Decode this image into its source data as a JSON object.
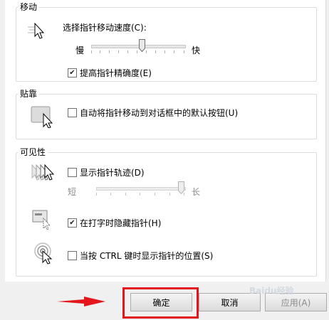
{
  "groups": {
    "motion": {
      "label": "移动",
      "speed_label": "选择指针移动速度(C):",
      "slow": "慢",
      "fast": "快",
      "speed_level": 0.55,
      "precision_label": "提高指针精确度(E)",
      "precision_checked": true
    },
    "snap": {
      "label": "贴靠",
      "snap_label": "自动将指针移动到对话框中的默认按钮(U)",
      "snap_checked": false
    },
    "visibility": {
      "label": "可见性",
      "trails_label": "显示指针轨迹(D)",
      "trails_checked": false,
      "short": "短",
      "long": "长",
      "trail_level": 1.0,
      "hide_label": "在打字时隐藏指针(H)",
      "hide_checked": true,
      "ctrl_label": "当按 CTRL 键时显示指针的位置(S)",
      "ctrl_checked": false
    }
  },
  "buttons": {
    "ok": "确定",
    "cancel": "取消",
    "apply": "应用(A)"
  },
  "watermark": "Baidu经验",
  "colors": {
    "highlight": "#e3161c"
  }
}
